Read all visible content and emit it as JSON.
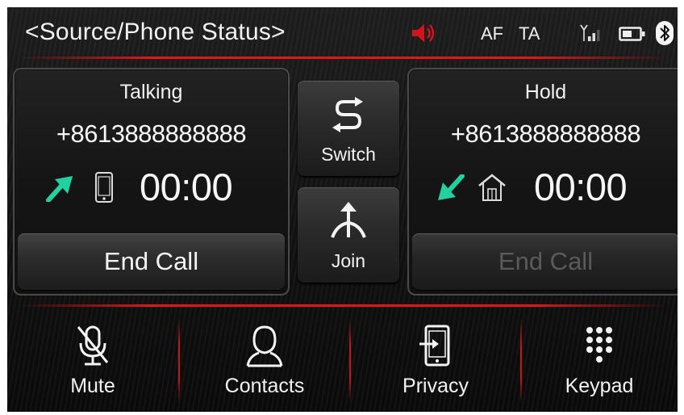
{
  "header": {
    "title": "<Source/Phone Status>",
    "af_label": "AF",
    "ta_label": "TA",
    "icons": [
      "speaker-icon",
      "signal-icon",
      "battery-icon",
      "bluetooth-icon"
    ]
  },
  "calls": {
    "active": {
      "status": "Talking",
      "number": "+8613888888888",
      "duration": "00:00",
      "direction_icon": "outgoing-arrow-icon",
      "device_icon": "mobile-phone-icon",
      "end_label": "End Call",
      "end_enabled": true
    },
    "hold": {
      "status": "Hold",
      "number": "+8613888888888",
      "duration": "00:00",
      "direction_icon": "incoming-arrow-icon",
      "device_icon": "home-icon",
      "end_label": "End Call",
      "end_enabled": false
    }
  },
  "center": {
    "switch_label": "Switch",
    "join_label": "Join"
  },
  "bottom_bar": {
    "items": [
      {
        "label": "Mute",
        "icon": "mute-microphone-icon"
      },
      {
        "label": "Contacts",
        "icon": "contacts-icon"
      },
      {
        "label": "Privacy",
        "icon": "privacy-icon"
      },
      {
        "label": "Keypad",
        "icon": "keypad-icon"
      }
    ]
  },
  "colors": {
    "accent_red": "#e0161b",
    "arrow_green": "#22d1a0",
    "text": "#f2f2f2",
    "muted_speaker": "#d4141a"
  }
}
